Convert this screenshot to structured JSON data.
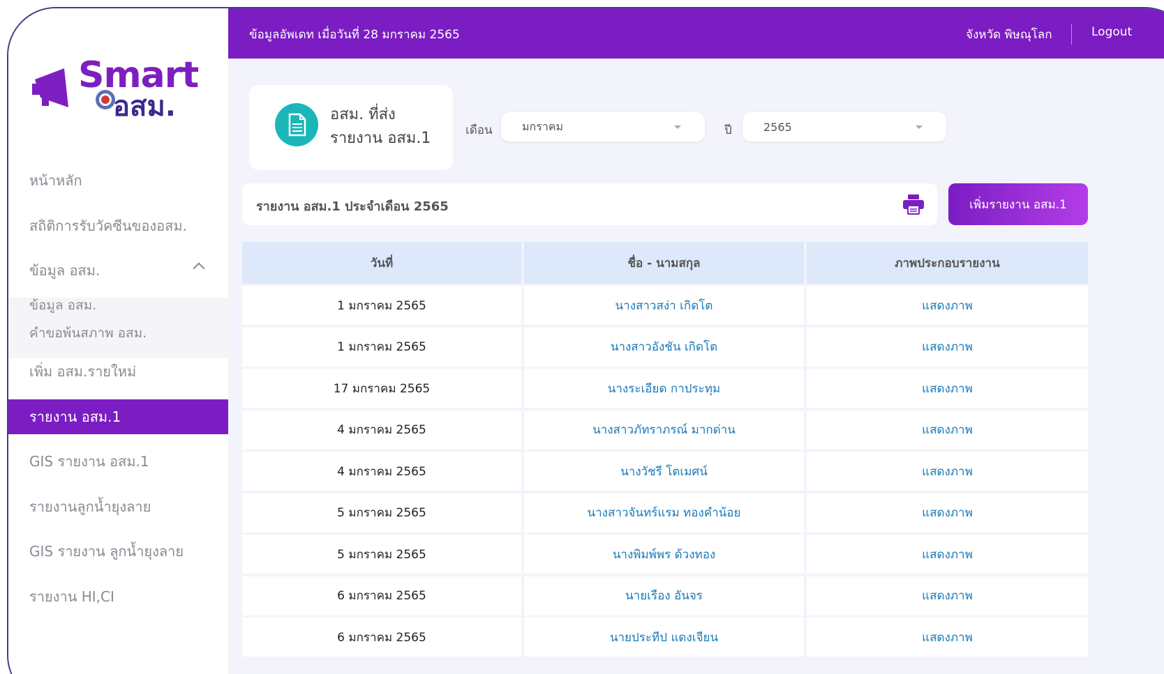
{
  "header": {
    "update_text": "ข้อมูลอัพเดท เมื่อวันที่ 28 มกราคม 2565",
    "province": "จังหวัด พิษณุโลก",
    "logout": "Logout"
  },
  "logo": {
    "line1": "Smart",
    "line2": "อสม."
  },
  "sidebar": {
    "items": [
      {
        "label": "หน้าหลัก"
      },
      {
        "label": "สถิติการรับวัคซีนของอสม."
      },
      {
        "label": "ข้อมูล อสม."
      },
      {
        "label": "เพิ่ม อสม.รายใหม่"
      },
      {
        "label": "รายงาน อสม.1"
      },
      {
        "label": "GIS รายงาน อสม.1"
      },
      {
        "label": "รายงานลูกน้ำยุงลาย"
      },
      {
        "label": "GIS รายงาน ลูกน้ำยุงลาย"
      },
      {
        "label": "รายงาน HI,CI"
      }
    ],
    "sub_items": [
      {
        "label": "ข้อมูล อสม."
      },
      {
        "label": "คำขอพ้นสภาพ อสม."
      }
    ]
  },
  "card": {
    "title_line1": "อสม. ที่ส่ง",
    "title_line2": "รายงาน อสม.1"
  },
  "filters": {
    "month_label": "เดือน",
    "month_value": "มกราคม",
    "year_label": "ปี",
    "year_value": "2565"
  },
  "report_bar": {
    "title": "รายงาน อสม.1 ประจำเดือน 2565"
  },
  "add_button": "เพิ่มรายงาน อสม.1",
  "table": {
    "headers": [
      "วันที่",
      "ชื่อ - นามสกุล",
      "ภาพประกอบรายงาน"
    ],
    "rows": [
      {
        "date": "1 มกราคม 2565",
        "name": "นางสาวสง่า เกิดโต",
        "image": "แสดงภาพ"
      },
      {
        "date": "1 มกราคม 2565",
        "name": "นางสาวอังชัน เกิดโต",
        "image": "แสดงภาพ"
      },
      {
        "date": "17 มกราคม 2565",
        "name": "นางระเอียด กาประทุม",
        "image": "แสดงภาพ"
      },
      {
        "date": "4 มกราคม 2565",
        "name": "นางสาวภัทราภรณ์ มากด่าน",
        "image": "แสดงภาพ"
      },
      {
        "date": "4 มกราคม 2565",
        "name": "นางวัชรี โตเมศน์",
        "image": "แสดงภาพ"
      },
      {
        "date": "5 มกราคม 2565",
        "name": "นางสาวจันทร์แรม ทองคำน้อย",
        "image": "แสดงภาพ"
      },
      {
        "date": "5 มกราคม 2565",
        "name": "นางพิมพ์พร ด้วงทอง",
        "image": "แสดงภาพ"
      },
      {
        "date": "6 มกราคม 2565",
        "name": "นายเรือง อันจร",
        "image": "แสดงภาพ"
      },
      {
        "date": "6 มกราคม 2565",
        "name": "นายประทีป แดงเจียน",
        "image": "แสดงภาพ"
      }
    ]
  },
  "colors": {
    "primary": "#7b1dc3",
    "accent_teal": "#1bb6b8",
    "link": "#1a7ab8",
    "header_row": "#dde8fb"
  }
}
